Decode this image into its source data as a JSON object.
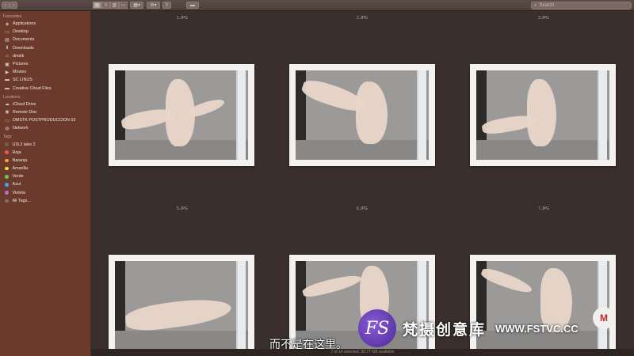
{
  "toolbar": {
    "search_placeholder": "Search",
    "back_icon": "chevron-left-icon",
    "forward_icon": "chevron-right-icon"
  },
  "sidebar": {
    "favourites_header": "Favourites",
    "favourites": [
      {
        "label": "Applications",
        "icon": "applications-icon"
      },
      {
        "label": "Desktop",
        "icon": "desktop-icon"
      },
      {
        "label": "Documents",
        "icon": "documents-icon"
      },
      {
        "label": "Downloads",
        "icon": "downloads-icon"
      },
      {
        "label": "dmstk",
        "icon": "home-icon"
      },
      {
        "label": "Pictures",
        "icon": "pictures-icon"
      },
      {
        "label": "Movies",
        "icon": "movies-icon"
      },
      {
        "label": "SC LINUS",
        "icon": "folder-icon"
      },
      {
        "label": "Creative Cloud Files",
        "icon": "folder-icon"
      }
    ],
    "locations_header": "Locations",
    "locations": [
      {
        "label": "iCloud Drive",
        "icon": "cloud-icon"
      },
      {
        "label": "Remote Disc",
        "icon": "disc-icon"
      },
      {
        "label": "DMSTK POSTPRODUCCION 03",
        "icon": "display-icon"
      },
      {
        "label": "Network",
        "icon": "network-icon"
      }
    ],
    "tags_header": "Tags",
    "tags": [
      {
        "label": "U3L2 take 2",
        "color": "#7a5a52"
      },
      {
        "label": "Roja",
        "color": "#e8574c"
      },
      {
        "label": "Naranja",
        "color": "#f0a040"
      },
      {
        "label": "Amarilla",
        "color": "#f1d54b"
      },
      {
        "label": "Verde",
        "color": "#66c455"
      },
      {
        "label": "Azul",
        "color": "#4c9be8"
      },
      {
        "label": "Violeta",
        "color": "#b26bd8"
      },
      {
        "label": "All Tags...",
        "color": "#8a6d65"
      }
    ]
  },
  "files": [
    "1.JPG",
    "2.JPG",
    "3.JPG",
    "5.JPG",
    "6.JPG",
    "7.JPG"
  ],
  "status": "7 of 14 selected, 30.77 GB available",
  "overlay": {
    "subtitle": "而不是在这里。",
    "watermark_logo": "FS",
    "watermark_text": "梵摄创意库",
    "watermark_url": "WWW.FSTVC.CC",
    "corner_badge": "M"
  }
}
